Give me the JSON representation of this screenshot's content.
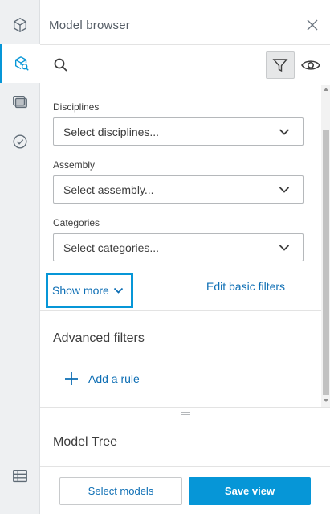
{
  "panel": {
    "title": "Model browser"
  },
  "rail": {
    "items": [
      {
        "icon": "cube-icon"
      },
      {
        "icon": "cube-search-icon",
        "active": true
      },
      {
        "icon": "layers-icon"
      },
      {
        "icon": "check-circle-icon"
      },
      {
        "icon": "table-icon"
      }
    ]
  },
  "filters": {
    "disciplines": {
      "label": "Disciplines",
      "placeholder": "Select disciplines..."
    },
    "assembly": {
      "label": "Assembly",
      "placeholder": "Select assembly..."
    },
    "categories": {
      "label": "Categories",
      "placeholder": "Select categories..."
    },
    "show_more": "Show more",
    "edit_basic": "Edit basic filters"
  },
  "advanced": {
    "title": "Advanced filters",
    "add_rule": "Add a rule"
  },
  "tree": {
    "title": "Model Tree"
  },
  "footer": {
    "select_models": "Select models",
    "save_view": "Save view"
  },
  "colors": {
    "accent": "#0696d7",
    "link": "#0d6eb4"
  }
}
